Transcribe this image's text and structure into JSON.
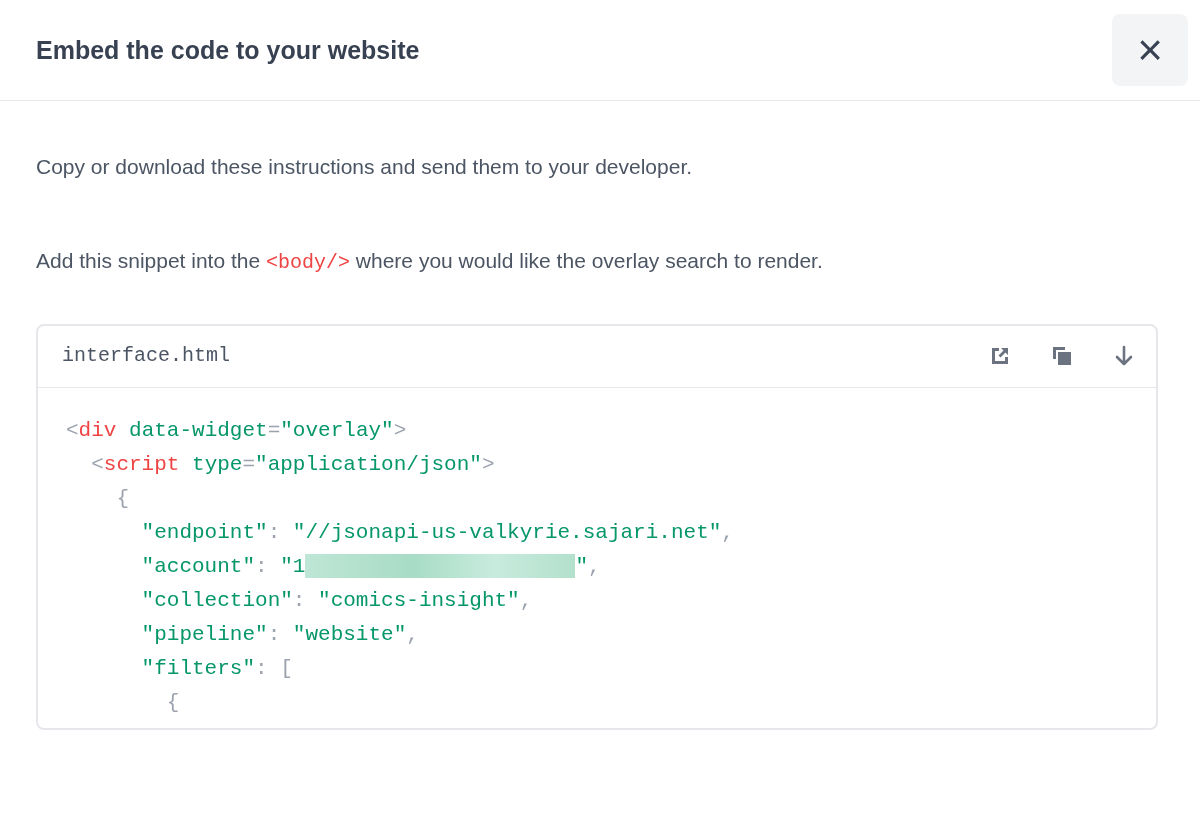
{
  "modal": {
    "title": "Embed the code to your website",
    "close_label": "×"
  },
  "paragraphs": [
    {
      "parts": [
        {
          "text": "Copy or download these instructions and send them to your developer.",
          "kind": "plain"
        }
      ]
    },
    {
      "parts": [
        {
          "text": "Add this snippet into the ",
          "kind": "plain"
        },
        {
          "text": "<body/>",
          "kind": "code"
        },
        {
          "text": " where you would like the overlay search to render.",
          "kind": "plain"
        }
      ]
    }
  ],
  "code_card": {
    "filename": "interface.html",
    "actions": [
      {
        "kind": "open"
      },
      {
        "kind": "copy"
      },
      {
        "kind": "download"
      }
    ],
    "lines": [
      {
        "tokens": [
          {
            "text": "<",
            "kind": "punct"
          },
          {
            "text": "div",
            "kind": "tag"
          },
          {
            "text": " data-widget",
            "kind": "attr"
          },
          {
            "text": "=",
            "kind": "punct"
          },
          {
            "text": "\"overlay\"",
            "kind": "string"
          },
          {
            "text": ">",
            "kind": "punct"
          }
        ]
      },
      {
        "tokens": [
          {
            "text": "  <",
            "kind": "punct"
          },
          {
            "text": "script",
            "kind": "tag"
          },
          {
            "text": " type",
            "kind": "attr"
          },
          {
            "text": "=",
            "kind": "punct"
          },
          {
            "text": "\"application/json\"",
            "kind": "string"
          },
          {
            "text": ">",
            "kind": "punct"
          }
        ]
      },
      {
        "tokens": [
          {
            "text": "    {",
            "kind": "punct"
          }
        ]
      },
      {
        "tokens": [
          {
            "text": "      \"endpoint\"",
            "kind": "string"
          },
          {
            "text": ": ",
            "kind": "punct"
          },
          {
            "text": "\"//jsonapi-us-valkyrie.sajari.net\"",
            "kind": "string"
          },
          {
            "text": ",",
            "kind": "punct"
          }
        ]
      },
      {
        "tokens": [
          {
            "text": "      \"account\"",
            "kind": "string"
          },
          {
            "text": ": ",
            "kind": "punct"
          },
          {
            "text": "\"1",
            "kind": "string"
          },
          {
            "kind": "redacted"
          },
          {
            "text": "\"",
            "kind": "string"
          },
          {
            "text": ",",
            "kind": "punct"
          }
        ]
      },
      {
        "tokens": [
          {
            "text": "      \"collection\"",
            "kind": "string"
          },
          {
            "text": ": ",
            "kind": "punct"
          },
          {
            "text": "\"comics-insight\"",
            "kind": "string"
          },
          {
            "text": ",",
            "kind": "punct"
          }
        ]
      },
      {
        "tokens": [
          {
            "text": "      \"pipeline\"",
            "kind": "string"
          },
          {
            "text": ": ",
            "kind": "punct"
          },
          {
            "text": "\"website\"",
            "kind": "string"
          },
          {
            "text": ",",
            "kind": "punct"
          }
        ]
      },
      {
        "tokens": [
          {
            "text": "      \"filters\"",
            "kind": "string"
          },
          {
            "text": ": ",
            "kind": "punct"
          },
          {
            "text": "[",
            "kind": "punct"
          }
        ]
      },
      {
        "tokens": [
          {
            "text": "        {",
            "kind": "punct"
          }
        ]
      }
    ]
  }
}
